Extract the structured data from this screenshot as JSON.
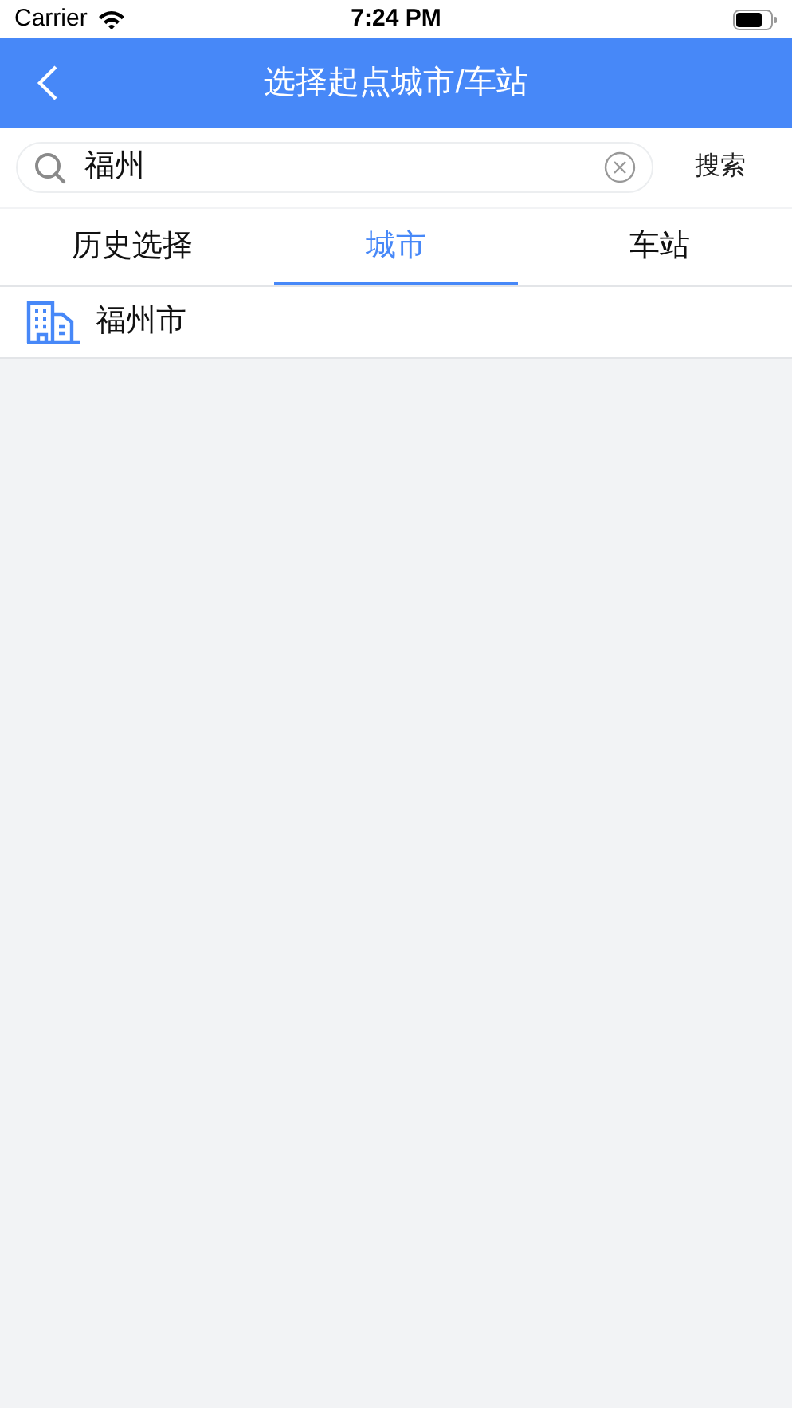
{
  "status_bar": {
    "carrier": "Carrier",
    "time": "7:24 PM"
  },
  "nav": {
    "title": "选择起点城市/车站"
  },
  "search": {
    "value": "福州",
    "button": "搜索"
  },
  "tabs": [
    {
      "label": "历史选择",
      "selected": false
    },
    {
      "label": "城市",
      "selected": true
    },
    {
      "label": "车站",
      "selected": false
    }
  ],
  "results": [
    {
      "name": "福州市"
    }
  ]
}
